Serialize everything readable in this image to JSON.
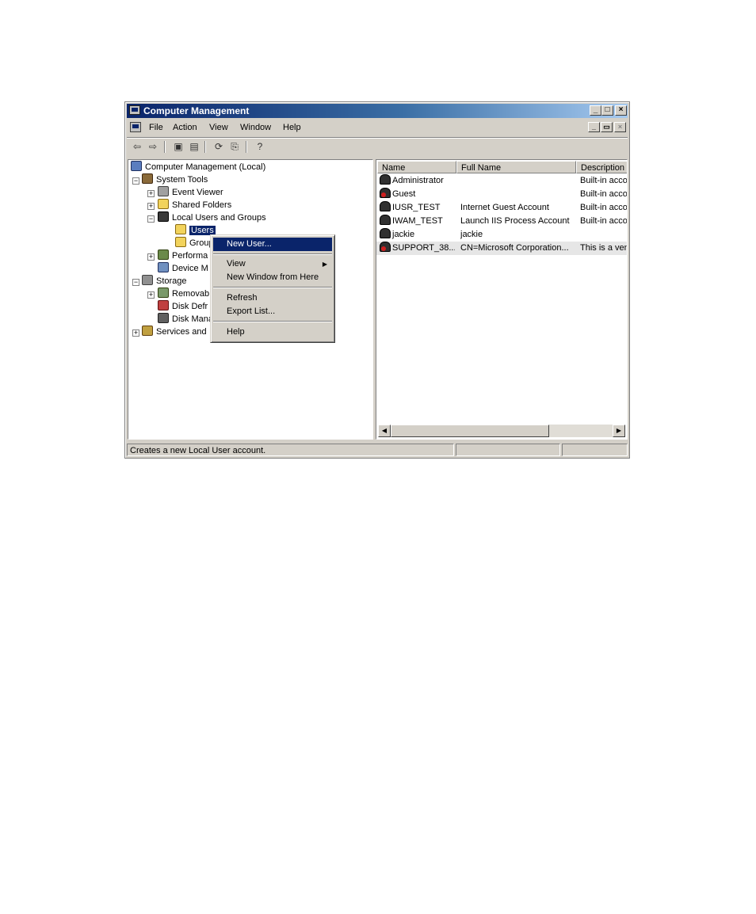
{
  "window": {
    "title": "Computer Management",
    "caption_buttons": [
      "_",
      "□",
      "×"
    ],
    "mdi_buttons": [
      "_",
      "▭",
      "×"
    ]
  },
  "menubar": {
    "items": [
      "File",
      "Action",
      "View",
      "Window",
      "Help"
    ]
  },
  "toolbar": {
    "buttons": [
      "back-arrow-icon",
      "forward-arrow-icon",
      "up-folder-icon",
      "show-hide-tree-icon",
      "refresh-icon",
      "export-list-icon",
      "help-icon"
    ]
  },
  "tree": {
    "root": "Computer Management (Local)",
    "system_tools": "System Tools",
    "event_viewer": "Event Viewer",
    "shared_folders": "Shared Folders",
    "local_users_groups": "Local Users and Groups",
    "users": "Users",
    "groups": "Group",
    "performance": "Performa",
    "device_manager": "Device M",
    "storage": "Storage",
    "removable": "Removab",
    "disk_defrag": "Disk Defr",
    "disk_mgmt": "Disk Mana",
    "services": "Services and"
  },
  "list": {
    "columns": [
      "Name",
      "Full Name",
      "Description"
    ],
    "rows": [
      {
        "name": "Administrator",
        "full_name": "",
        "description": "Built-in accou"
      },
      {
        "name": "Guest",
        "full_name": "",
        "description": "Built-in accou"
      },
      {
        "name": "IUSR_TEST",
        "full_name": "Internet Guest Account",
        "description": "Built-in accou"
      },
      {
        "name": "IWAM_TEST",
        "full_name": "Launch IIS Process Account",
        "description": "Built-in accou"
      },
      {
        "name": "jackie",
        "full_name": "jackie",
        "description": ""
      },
      {
        "name": "SUPPORT_38...",
        "full_name": "CN=Microsoft Corporation...",
        "description": "This is a ven"
      }
    ]
  },
  "context_menu": {
    "new_user": "New User...",
    "view": "View",
    "new_window": "New Window from Here",
    "refresh": "Refresh",
    "export_list": "Export List...",
    "help": "Help"
  },
  "statusbar": {
    "text": "Creates a new Local User account."
  },
  "colors": {
    "title_gradient_start": "#0a246a",
    "title_gradient_end": "#a6caf0",
    "selection": "#0a246a",
    "face": "#d4d0c8"
  }
}
